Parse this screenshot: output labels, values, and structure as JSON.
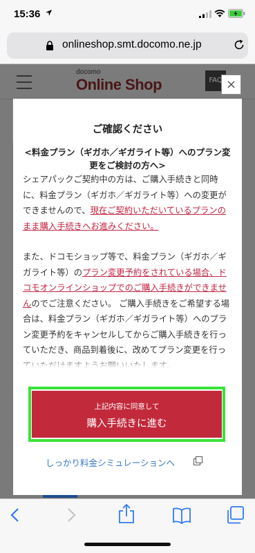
{
  "status_bar": {
    "time": "15:36"
  },
  "browser": {
    "url": "onlineshop.smt.docomo.ne.jp"
  },
  "site_header": {
    "logo_small": "docomo",
    "logo_main": "Online Shop",
    "faq_label": "FAQ"
  },
  "modal": {
    "close_label": "×",
    "title": "ご確認ください",
    "notice_heading": "<料金プラン（ギガホ／ギガライト等）へのプラン変更をご検討の方へ>",
    "paragraph1": {
      "text": "シェアパックご契約中の方は、ご購入手続きと同時に、料金プラン（ギガホ／ギガライト等）への変更ができませんので、",
      "link": "現在ご契約いただいているプランのまま購入手続きへお進みください。"
    },
    "paragraph2": {
      "text_before": "また、ドコモショップ等で、料金プラン（ギガホ／ギガライト等）の",
      "link": "プラン変更予約をされている場合、ドコモオンラインショップでのご購入手続きができません",
      "text_after": "のでご注意ください。 ご購入手続きをご希望する場合は、料金プラン（ギガホ／ギガライト等）へのプラン変更予約をキャンセルしてからご購入手続きを行っていただき、商品到着後に、改めてプラン変更を行っていただけますようお願いいたします。"
    },
    "proceed_button": {
      "sub_label": "上記内容に同意して",
      "main_label": "購入手続きに進む"
    },
    "simulation_link": "しっかり料金シミュレーションへ"
  },
  "colors": {
    "accent_red": "#c22a3c",
    "link_red": "#c3243f",
    "link_blue": "#3a78c7",
    "focus_green": "#3ae23a"
  },
  "icons": [
    "location-arrow-icon",
    "signal-icon",
    "wifi-icon",
    "battery-charging-icon",
    "lock-icon",
    "reload-icon",
    "hamburger-menu-icon",
    "close-icon",
    "external-window-icon",
    "back-icon",
    "forward-icon",
    "share-icon",
    "bookmarks-icon",
    "tabs-icon"
  ]
}
